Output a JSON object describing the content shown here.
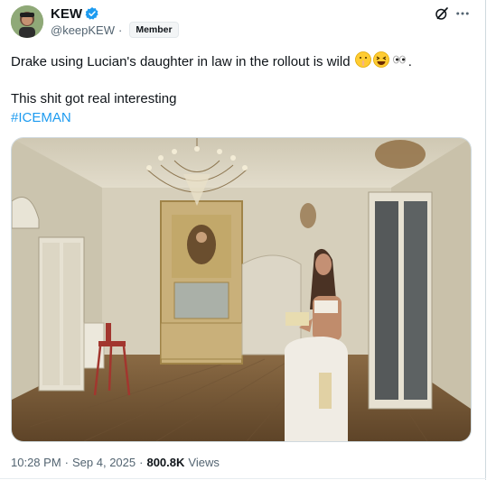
{
  "author": {
    "display_name": "KEW",
    "handle": "@keepKEW",
    "handle_sep": "·",
    "badge": "Member",
    "verified_color": "#1d9bf0"
  },
  "tweet": {
    "line1": "Drake using Lucian's daughter in law in the rollout is wild",
    "line1_emojis": [
      "shushing-face",
      "grinning-squinting-face",
      "eyes"
    ],
    "line1_end": ".",
    "line2": "This shit got real interesting",
    "hashtag": "#ICEMAN"
  },
  "footer": {
    "time": "10:28 PM",
    "sep1": "·",
    "date": "Sep 4, 2025",
    "sep2": "·",
    "views_count": "800.8K",
    "views_label": "Views"
  },
  "media": {
    "description_icon": "photo-of-ornate-room-with-chandelier-and-woman"
  },
  "colors": {
    "link": "#1d9bf0",
    "secondary_text": "#536471",
    "primary_text": "#0f1419"
  }
}
